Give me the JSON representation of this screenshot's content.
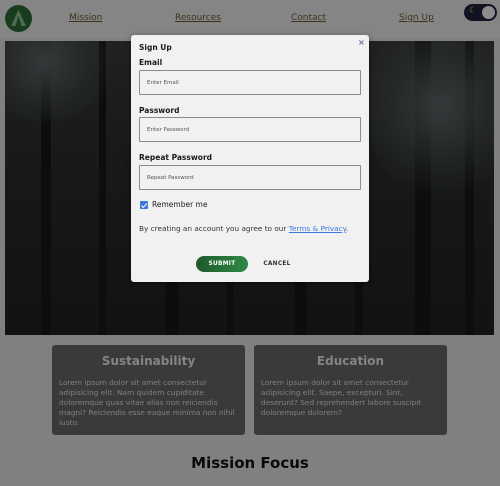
{
  "nav": {
    "links": [
      "Mission",
      "Resources",
      "Contact",
      "Sign Up"
    ]
  },
  "cards": [
    {
      "title": "Sustainability",
      "text": "Lorem ipsum dolor sit amet consectetur adipisicing elit. Nam quidem cupiditate doloremque quas vitae alias non reiciendis magni? Reiciendis esse eaque minima non nihil iusto."
    },
    {
      "title": "Education",
      "text": "Lorem ipsum dolor sit amet consectetur adipisicing elit. Saepe, excepturi. Sint, deserunt? Sed reprehendert labore suscipit doloremque dolorem?"
    }
  ],
  "section_title": "Mission Focus",
  "modal": {
    "title": "Sign Up",
    "close_symbol": "×",
    "email_label": "Email",
    "email_placeholder": "Enter Email",
    "password_label": "Password",
    "password_placeholder": "Enter Password",
    "repeat_label": "Repeat Password",
    "repeat_placeholder": "Repeat Password",
    "remember_label": "Remember me",
    "remember_checked": true,
    "terms_prefix": "By creating an account you agree to our ",
    "terms_link": "Terms & Privacy",
    "terms_suffix": ".",
    "submit_label": "SUBMIT",
    "cancel_label": "CANCEL"
  },
  "colors": {
    "accent_green": "#2f6d3a",
    "link_blue": "#3a7be0",
    "checkbox_blue": "#3f77d6"
  },
  "icons": {
    "logo": "tent-triangle-icon",
    "theme": "moon-icon"
  }
}
